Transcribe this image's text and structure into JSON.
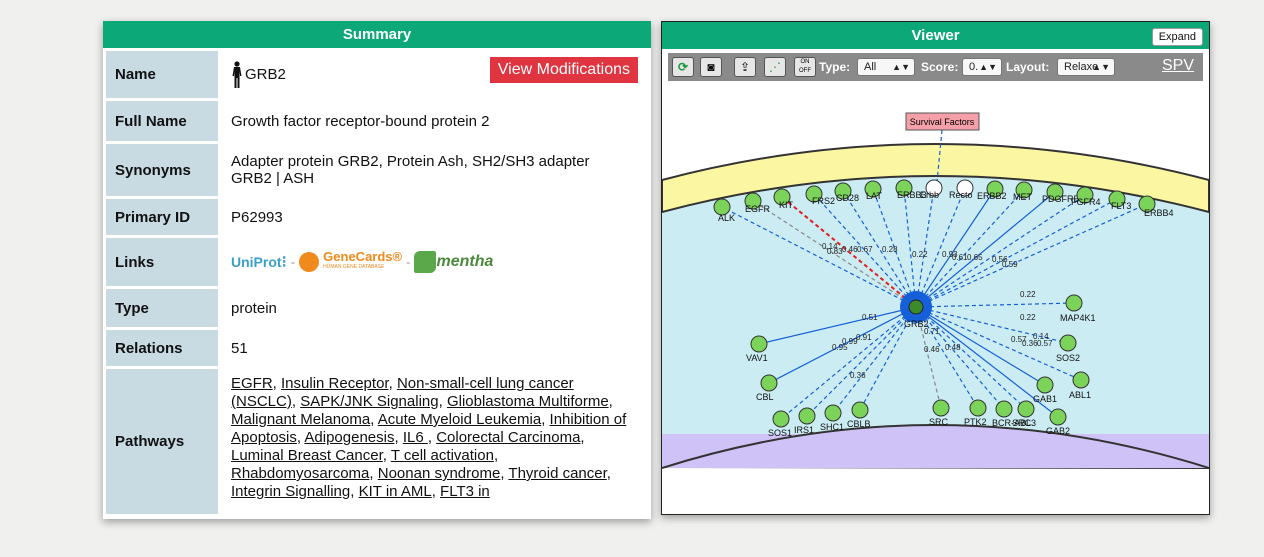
{
  "summary": {
    "title": "Summary",
    "modifications_button": "View Modifications",
    "rows": {
      "name": {
        "label": "Name",
        "value": "GRB2"
      },
      "full_name": {
        "label": "Full Name",
        "value": "Growth factor receptor-bound protein 2"
      },
      "synonyms": {
        "label": "Synonyms",
        "line1": "Adapter protein GRB2, Protein Ash, SH2/SH3 adapter",
        "line2": "GRB2 | ASH"
      },
      "primary_id": {
        "label": "Primary ID",
        "value": "P62993"
      },
      "links": {
        "label": "Links",
        "uniprot": "UniProt",
        "genecards": "GeneCards®",
        "genecards_sub": "HUMAN GENE DATABASE",
        "mentha": "mentha",
        "separator": "-"
      },
      "type": {
        "label": "Type",
        "value": "protein"
      },
      "relations": {
        "label": "Relations",
        "value": "51"
      },
      "pathways": {
        "label": "Pathways",
        "items": [
          "EGFR",
          "Insulin Receptor",
          "Non-small-cell lung cancer (NSCLC)",
          "SAPK/JNK Signaling",
          "Glioblastoma Multiforme",
          "Malignant Melanoma",
          "Acute Myeloid Leukemia",
          "Inhibition of Apoptosis",
          "Adipogenesis",
          "IL6 ",
          "Colorectal Carcinoma",
          "Luminal Breast Cancer",
          "T cell activation",
          "Rhabdomyosarcoma",
          "Noonan syndrome",
          "Thyroid cancer",
          "Integrin Signalling",
          "KIT in AML",
          "FLT3 in"
        ]
      }
    }
  },
  "viewer": {
    "title": "Viewer",
    "expand_button": "Expand",
    "toolbar": {
      "icons": [
        "refresh-icon",
        "camera-icon",
        "export-icon",
        "network-icon",
        "toggle-labels-icon"
      ],
      "toggle_labels_text": "ON OFF",
      "type_label": "Type:",
      "type_value": "All",
      "score_label": "Score:",
      "score_value": "0.",
      "layout_label": "Layout:",
      "layout_value": "Relaxe",
      "spv_link": "SPV"
    },
    "colors": {
      "membrane": "#fbf6a2",
      "cytoplasm": "#c9ecf2",
      "nucleus": "#cfc2f7",
      "node": "#7cd35a",
      "edge": "#1560d8",
      "red_edge": "#e02020"
    },
    "survival_factors": "Survival Factors",
    "center": "GRB2",
    "membrane_nodes": [
      {
        "label": "ALK",
        "fill": "green"
      },
      {
        "label": "EGFR",
        "fill": "green"
      },
      {
        "label": "KIT",
        "fill": "green"
      },
      {
        "label": "FRS2",
        "fill": "green"
      },
      {
        "label": "CD28",
        "fill": "green"
      },
      {
        "label": "LAT",
        "fill": "green"
      },
      {
        "label": "ERBB3",
        "fill": "green"
      },
      {
        "label": "Erbb",
        "fill": "white"
      },
      {
        "label": "Recto",
        "fill": "white"
      },
      {
        "label": "ERBB2",
        "fill": "green"
      },
      {
        "label": "MET",
        "fill": "green"
      },
      {
        "label": "PDGFRB",
        "fill": "green"
      },
      {
        "label": "FGFR4",
        "fill": "green"
      },
      {
        "label": "FLT3",
        "fill": "green"
      },
      {
        "label": "ERBB4",
        "fill": "green"
      }
    ],
    "cytoplasm_nodes": [
      "MAP4K1",
      "SOS2",
      "ABL1",
      "GAB1",
      "GAB2",
      "SRC3",
      "BCR-ABL",
      "PTK2",
      "SRC",
      "CBLB",
      "SHC1",
      "IRS1",
      "SOS1",
      "CBL",
      "VAV1"
    ],
    "edge_scores": [
      "0.22",
      "0.22",
      "0.14",
      "0.57",
      "0.36",
      "0.57",
      "0.51",
      "0.91",
      "0.99",
      "0.95",
      "0.36",
      "0.46",
      "0.48",
      "0.71",
      "0.14",
      "0.83",
      "0.46",
      "0.67",
      "0.28",
      "0.22",
      "0.93",
      "0.61",
      "0.65",
      "0.56",
      "0.59"
    ]
  }
}
